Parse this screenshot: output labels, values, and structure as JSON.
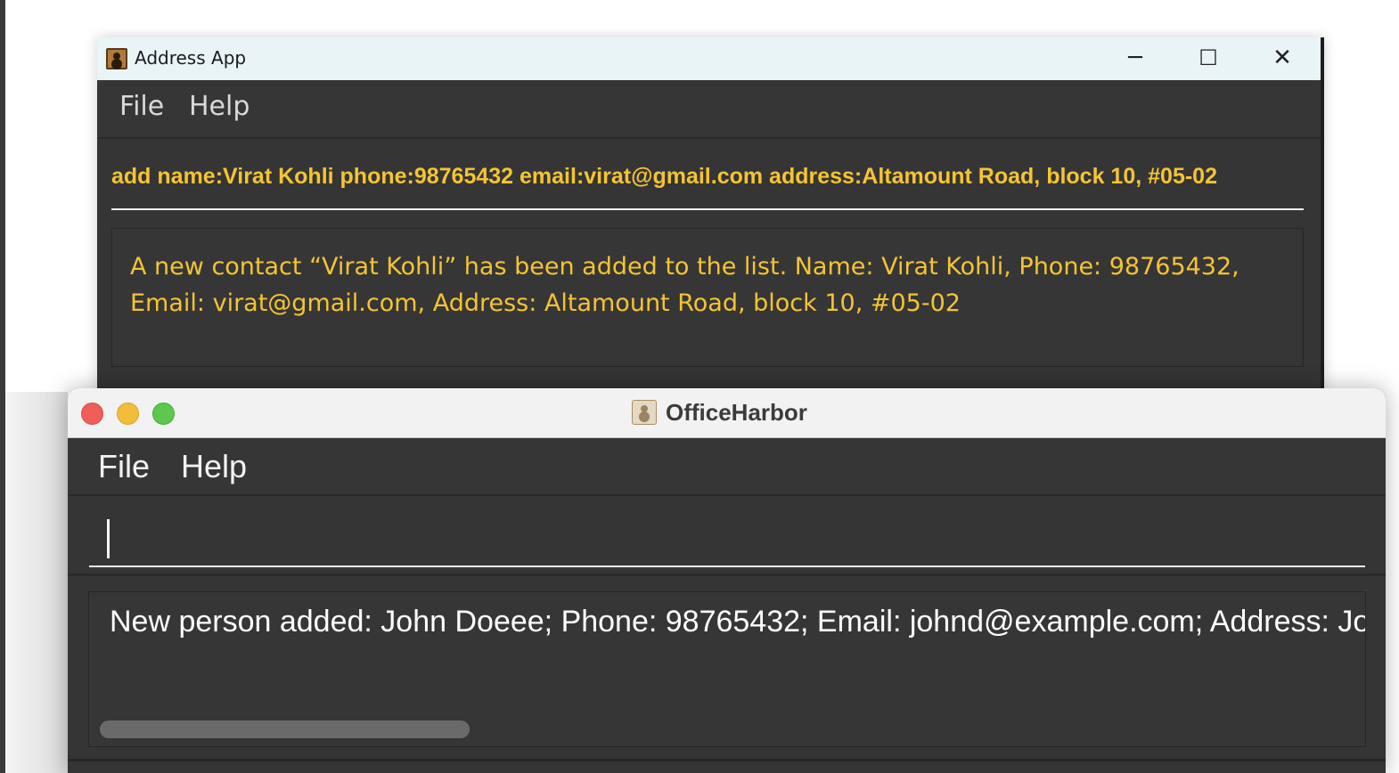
{
  "address_app": {
    "title": "Address App",
    "controls": {
      "minimize": "─",
      "maximize": "☐",
      "close": "✕"
    },
    "menu": [
      "File",
      "Help"
    ],
    "command_text": "add name:Virat Kohli phone:98765432 email:virat@gmail.com address:Altamount Road, block 10, #05-02",
    "result_text": "A new contact “Virat Kohli” has been added to the list. Name: Virat Kohli, Phone: 98765432, Email: virat@gmail.com, Address: Altamount Road, block 10, #05-02",
    "accent_color": "#f5c432"
  },
  "office_harbor": {
    "title": "OfficeHarbor",
    "menu": [
      "File",
      "Help"
    ],
    "command_value": "",
    "result_text": "New person added: John Doeee; Phone: 98765432; Email: johnd@example.com; Address: Johnst",
    "traffic_lights": {
      "close_color": "#ee5f57",
      "minimize_color": "#f3bd3c",
      "zoom_color": "#5dc84d"
    }
  }
}
